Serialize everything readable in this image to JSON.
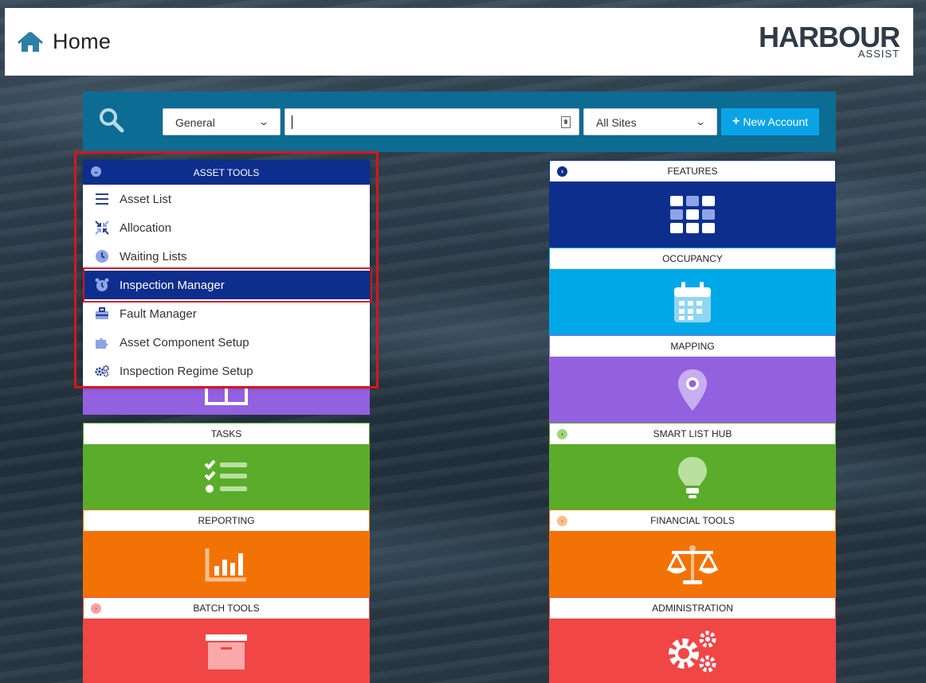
{
  "header": {
    "title": "Home",
    "logo_main": "HARBOUR",
    "logo_sub": "ASSIST"
  },
  "search": {
    "category": "General",
    "input_value": "",
    "sites": "All Sites",
    "new_account": "New Account"
  },
  "asset_tools": {
    "title": "ASSET TOOLS",
    "items": [
      {
        "label": "Asset List",
        "icon": "list-icon"
      },
      {
        "label": "Allocation",
        "icon": "allocation-icon"
      },
      {
        "label": "Waiting Lists",
        "icon": "clock-icon"
      },
      {
        "label": "Inspection Manager",
        "icon": "alarm-clock-icon",
        "active": true
      },
      {
        "label": "Fault Manager",
        "icon": "toolbox-icon"
      },
      {
        "label": "Asset Component Setup",
        "icon": "puzzle-icon"
      },
      {
        "label": "Inspection Regime Setup",
        "icon": "cogs-icon"
      }
    ]
  },
  "tiles": {
    "features": "FEATURES",
    "occupancy": "OCCUPANCY",
    "mapping": "MAPPING",
    "tasks": "TASKS",
    "smart_list_hub": "SMART LIST HUB",
    "reporting": "REPORTING",
    "financial_tools": "FINANCIAL TOOLS",
    "batch_tools": "BATCH TOOLS",
    "administration": "ADMINISTRATION"
  },
  "colors": {
    "navy": "#0d2e8c",
    "sky": "#00a8e8",
    "purple": "#9360e0",
    "green": "#5bac2a",
    "orange": "#f37206",
    "red": "#f04646",
    "searchbar": "#0d6c93"
  }
}
